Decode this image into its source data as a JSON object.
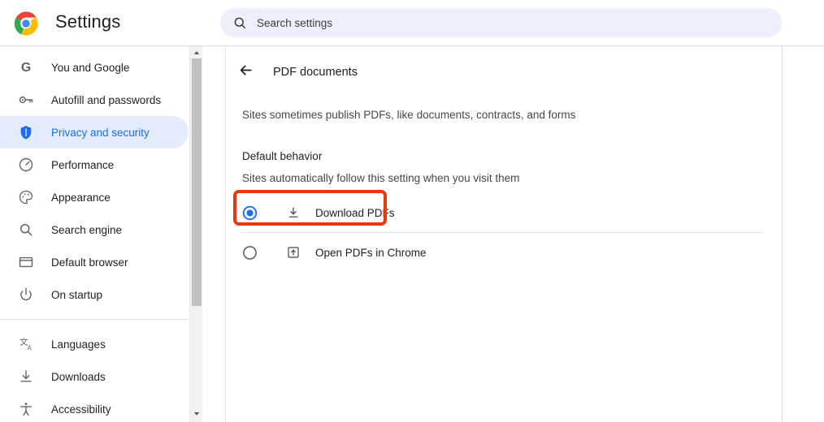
{
  "app": {
    "title": "Settings",
    "logo_icon": "chrome-logo"
  },
  "search": {
    "placeholder": "Search settings",
    "value": "",
    "icon": "search-icon"
  },
  "sidebar": {
    "groups": [
      {
        "items": [
          {
            "label": "You and Google",
            "icon": "google-g-icon",
            "selected": false
          },
          {
            "label": "Autofill and passwords",
            "icon": "key-icon",
            "selected": false
          },
          {
            "label": "Privacy and security",
            "icon": "shield-icon",
            "selected": true
          },
          {
            "label": "Performance",
            "icon": "speedometer-icon",
            "selected": false
          },
          {
            "label": "Appearance",
            "icon": "palette-icon",
            "selected": false
          },
          {
            "label": "Search engine",
            "icon": "search-icon",
            "selected": false
          },
          {
            "label": "Default browser",
            "icon": "window-icon",
            "selected": false
          },
          {
            "label": "On startup",
            "icon": "power-icon",
            "selected": false
          }
        ]
      },
      {
        "items": [
          {
            "label": "Languages",
            "icon": "translate-icon",
            "selected": false
          },
          {
            "label": "Downloads",
            "icon": "download-icon",
            "selected": false
          },
          {
            "label": "Accessibility",
            "icon": "accessibility-icon",
            "selected": false
          }
        ]
      }
    ],
    "scrollbar": {
      "up_arrow_icon": "triangle-up-icon",
      "down_arrow_icon": "triangle-down-icon"
    }
  },
  "main": {
    "back_icon": "arrow-left-icon",
    "page_title": "PDF documents",
    "intro": "Sites sometimes publish PDFs, like documents, contracts, and forms",
    "section_title": "Default behavior",
    "section_subtitle": "Sites automatically follow this setting when you visit them",
    "options": [
      {
        "label": "Download PDFs",
        "icon": "download-icon",
        "selected": true,
        "highlighted": true
      },
      {
        "label": "Open PDFs in Chrome",
        "icon": "open-in-new-icon",
        "selected": false,
        "highlighted": false
      }
    ]
  },
  "colors": {
    "accent_blue": "#1b6ef3",
    "selected_pill": "#e3ecfd",
    "search_bg": "#eceff7",
    "annotation_red": "#e8380d",
    "text_primary": "#1f1f1f",
    "text_secondary": "#44474a"
  }
}
